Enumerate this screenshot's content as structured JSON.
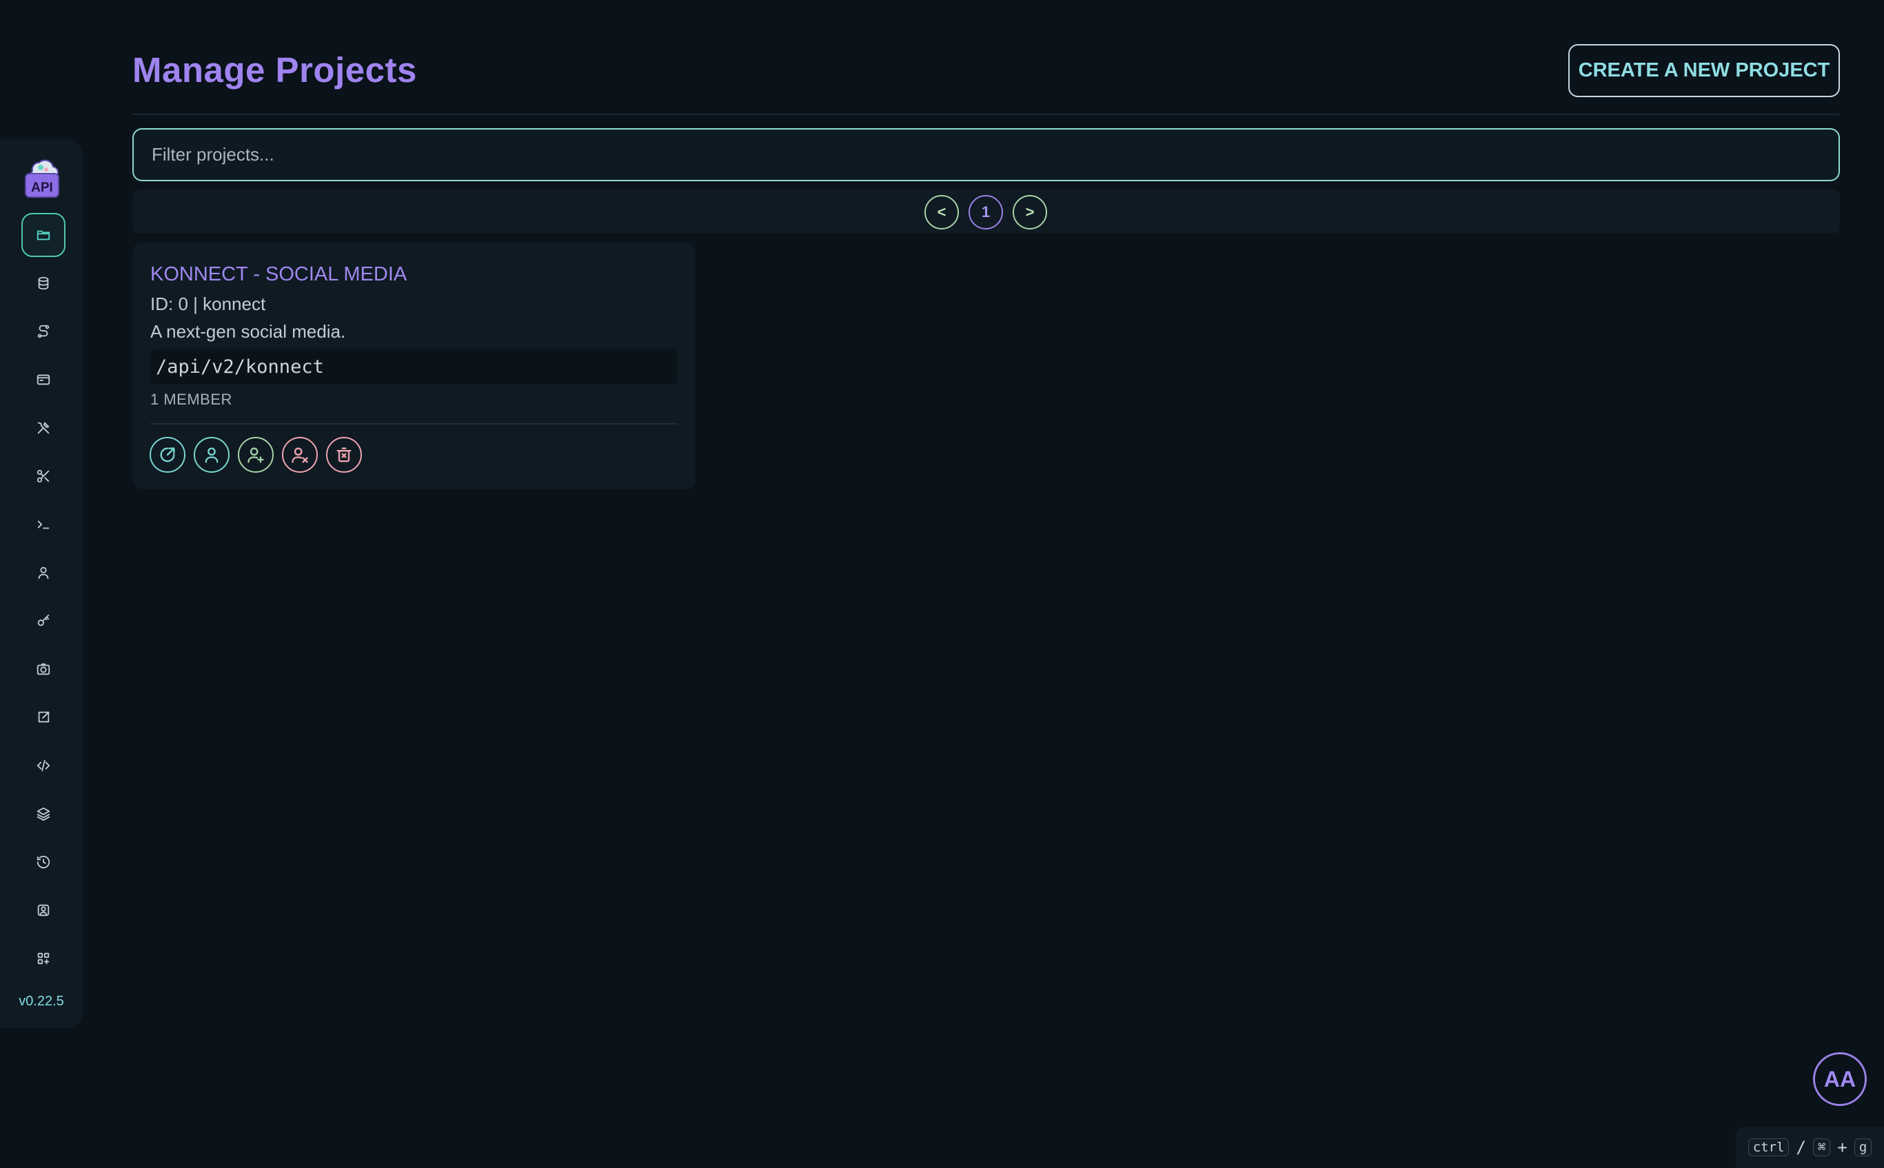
{
  "sidebar": {
    "logo_icon": "api-cloud-gear-logo",
    "logo_text": "API",
    "version": "v0.22.5",
    "items": [
      {
        "name": "projects",
        "icon": "folder-icon",
        "active": true
      },
      {
        "name": "database",
        "icon": "database-icon",
        "active": false
      },
      {
        "name": "routes",
        "icon": "route-icon",
        "active": false
      },
      {
        "name": "browser",
        "icon": "window-icon",
        "active": false
      },
      {
        "name": "tools",
        "icon": "tools-icon",
        "active": false
      },
      {
        "name": "cut",
        "icon": "scissors-icon",
        "active": false
      },
      {
        "name": "terminal",
        "icon": "terminal-icon",
        "active": false
      },
      {
        "name": "users",
        "icon": "user-icon",
        "active": false
      },
      {
        "name": "keys",
        "icon": "key-icon",
        "active": false
      },
      {
        "name": "snapshots",
        "icon": "camera-icon",
        "active": false
      },
      {
        "name": "external",
        "icon": "external-link-icon",
        "active": false
      },
      {
        "name": "code",
        "icon": "code-icon",
        "active": false
      },
      {
        "name": "layers",
        "icon": "layers-icon",
        "active": false
      },
      {
        "name": "history",
        "icon": "history-icon",
        "active": false
      },
      {
        "name": "user-settings",
        "icon": "user-gear-icon",
        "active": false
      },
      {
        "name": "apps",
        "icon": "apps-icon",
        "active": false
      }
    ]
  },
  "header": {
    "title": "Manage Projects",
    "create_label": "CREATE A NEW PROJECT"
  },
  "filter": {
    "placeholder": "Filter projects...",
    "value": ""
  },
  "pagination": {
    "prev_label": "<",
    "current_page": "1",
    "next_label": ">"
  },
  "projects": [
    {
      "title": "KONNECT - SOCIAL MEDIA",
      "id_line": "ID: 0 | konnect",
      "description": "A next-gen social media.",
      "path": "/api/v2/konnect",
      "members": "1 MEMBER",
      "actions": [
        "external-link-icon",
        "user-icon",
        "user-plus-icon",
        "user-x-icon",
        "trash-icon"
      ]
    }
  ],
  "avatar": {
    "initials": "AA"
  },
  "shortcut": {
    "k1": "ctrl",
    "sep1": "/",
    "k2": "⌘",
    "sep2": "+",
    "k3": "g"
  },
  "colors": {
    "background": "#0a121a",
    "panel": "#0f1a23",
    "accent_purple": "#9f84ef",
    "accent_teal": "#79d7d0",
    "accent_green": "#a9d3a7",
    "accent_pink": "#f0a5b0"
  }
}
